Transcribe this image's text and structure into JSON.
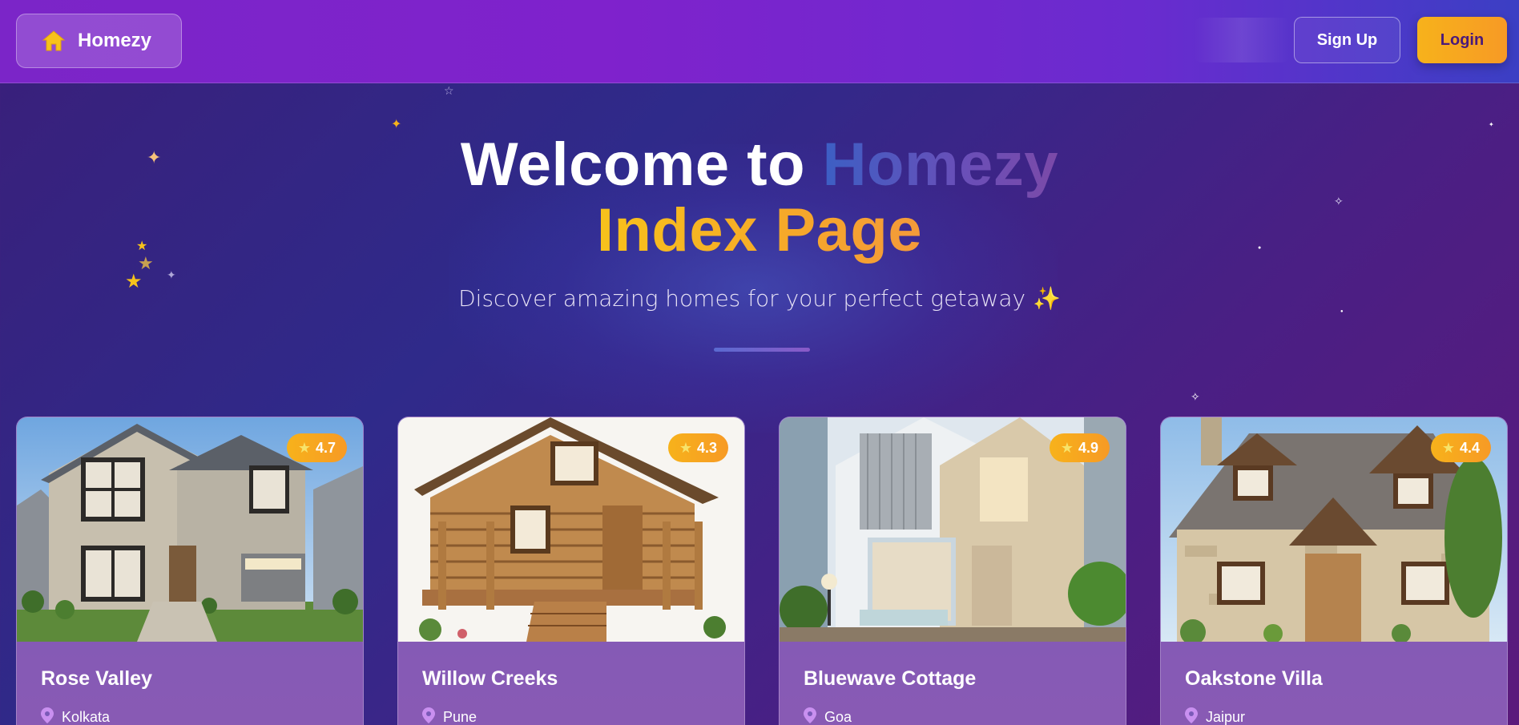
{
  "brand": {
    "name": "Homezy",
    "icon": "home-icon"
  },
  "nav": {
    "signup_label": "Sign Up",
    "login_label": "Login"
  },
  "hero": {
    "title_prefix": "Welcome to ",
    "title_accent": "Homezy",
    "title_line2": "Index Page",
    "subtitle": "Discover amazing homes for your perfect getaway ✨"
  },
  "listings": [
    {
      "name": "Rose Valley",
      "location": "Kolkata",
      "rating": "4.7"
    },
    {
      "name": "Willow Creeks",
      "location": "Pune",
      "rating": "4.3"
    },
    {
      "name": "Bluewave Cottage",
      "location": "Goa",
      "rating": "4.9"
    },
    {
      "name": "Oakstone Villa",
      "location": "Jaipur",
      "rating": "4.4"
    }
  ],
  "colors": {
    "accent_gold": "#f7b21b",
    "nav_purple": "#7b25c8",
    "card_purple": "#7a5ab8"
  }
}
